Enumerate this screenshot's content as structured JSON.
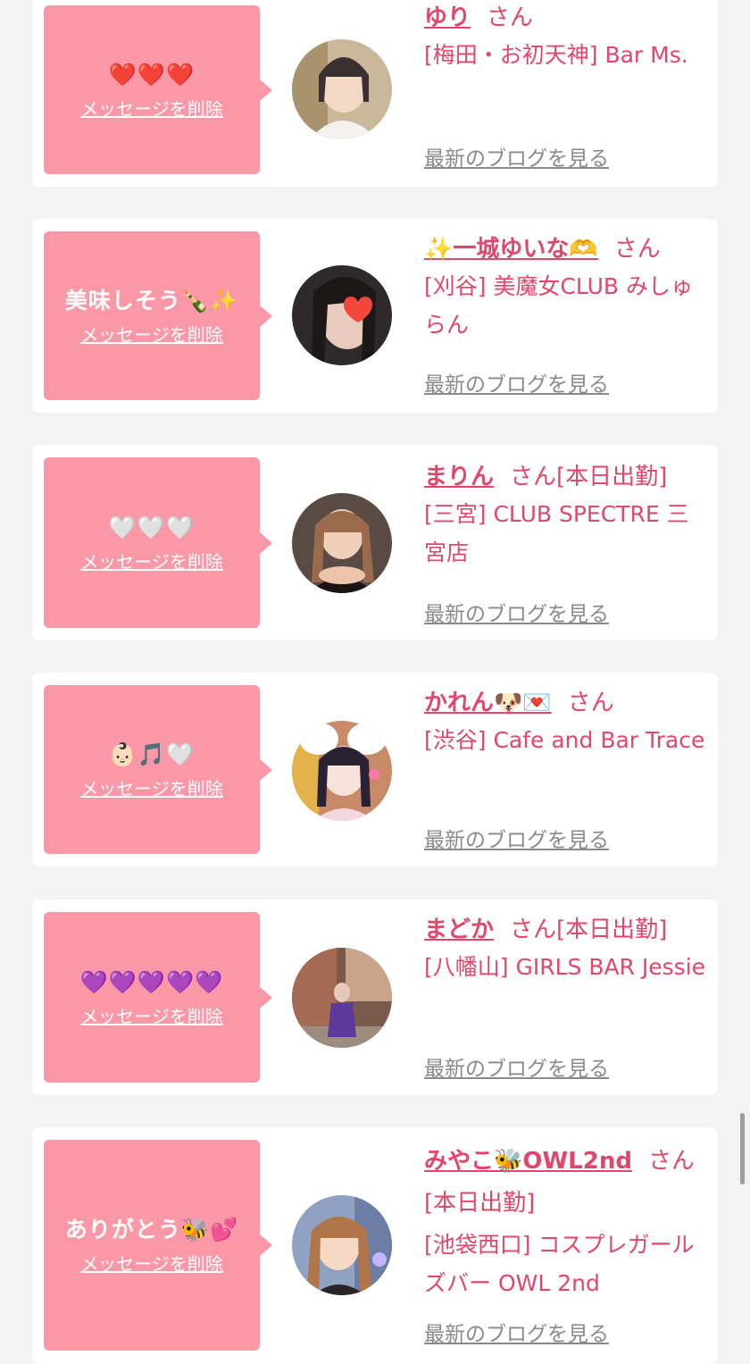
{
  "delete_label": "メッセージを削除",
  "blog_label": "最新のブログを見る",
  "san_label": "さん",
  "accent_color": "#e2466a",
  "bubble_color": "#fb98a8",
  "cards": [
    {
      "message": "❤️❤️❤️",
      "name": "ゆり",
      "san": "さん",
      "shop": "[梅田・お初天神] Bar Ms.",
      "blog": "最新のブログを見る"
    },
    {
      "message": "美味しそう🍾✨",
      "name": "✨一城ゆいな🫶",
      "san": "さん",
      "shop": "[刈谷] 美魔女CLUB みしゅらん",
      "blog": "最新のブログを見る"
    },
    {
      "message": "🤍🤍🤍",
      "name": "まりん",
      "san": "さん[本日出勤]",
      "shop": "[三宮] CLUB SPECTRE 三宮店",
      "blog": "最新のブログを見る"
    },
    {
      "message": "👶🏻🎵🤍",
      "name": "かれん🐶💌",
      "san": "さん",
      "shop": "[渋谷] Cafe and Bar Trace",
      "blog": "最新のブログを見る"
    },
    {
      "message": "💜💜💜💜💜",
      "name": "まどか",
      "san": "さん[本日出勤]",
      "shop": "[八幡山] GIRLS BAR Jessie",
      "blog": "最新のブログを見る"
    },
    {
      "message": "ありがとう🐝💕",
      "name": "みやこ🐝OWL2nd",
      "san": "さん[本日出勤]",
      "shop": "[池袋西口] コスプレガールズバー OWL 2nd",
      "blog": "最新のブログを見る"
    }
  ]
}
